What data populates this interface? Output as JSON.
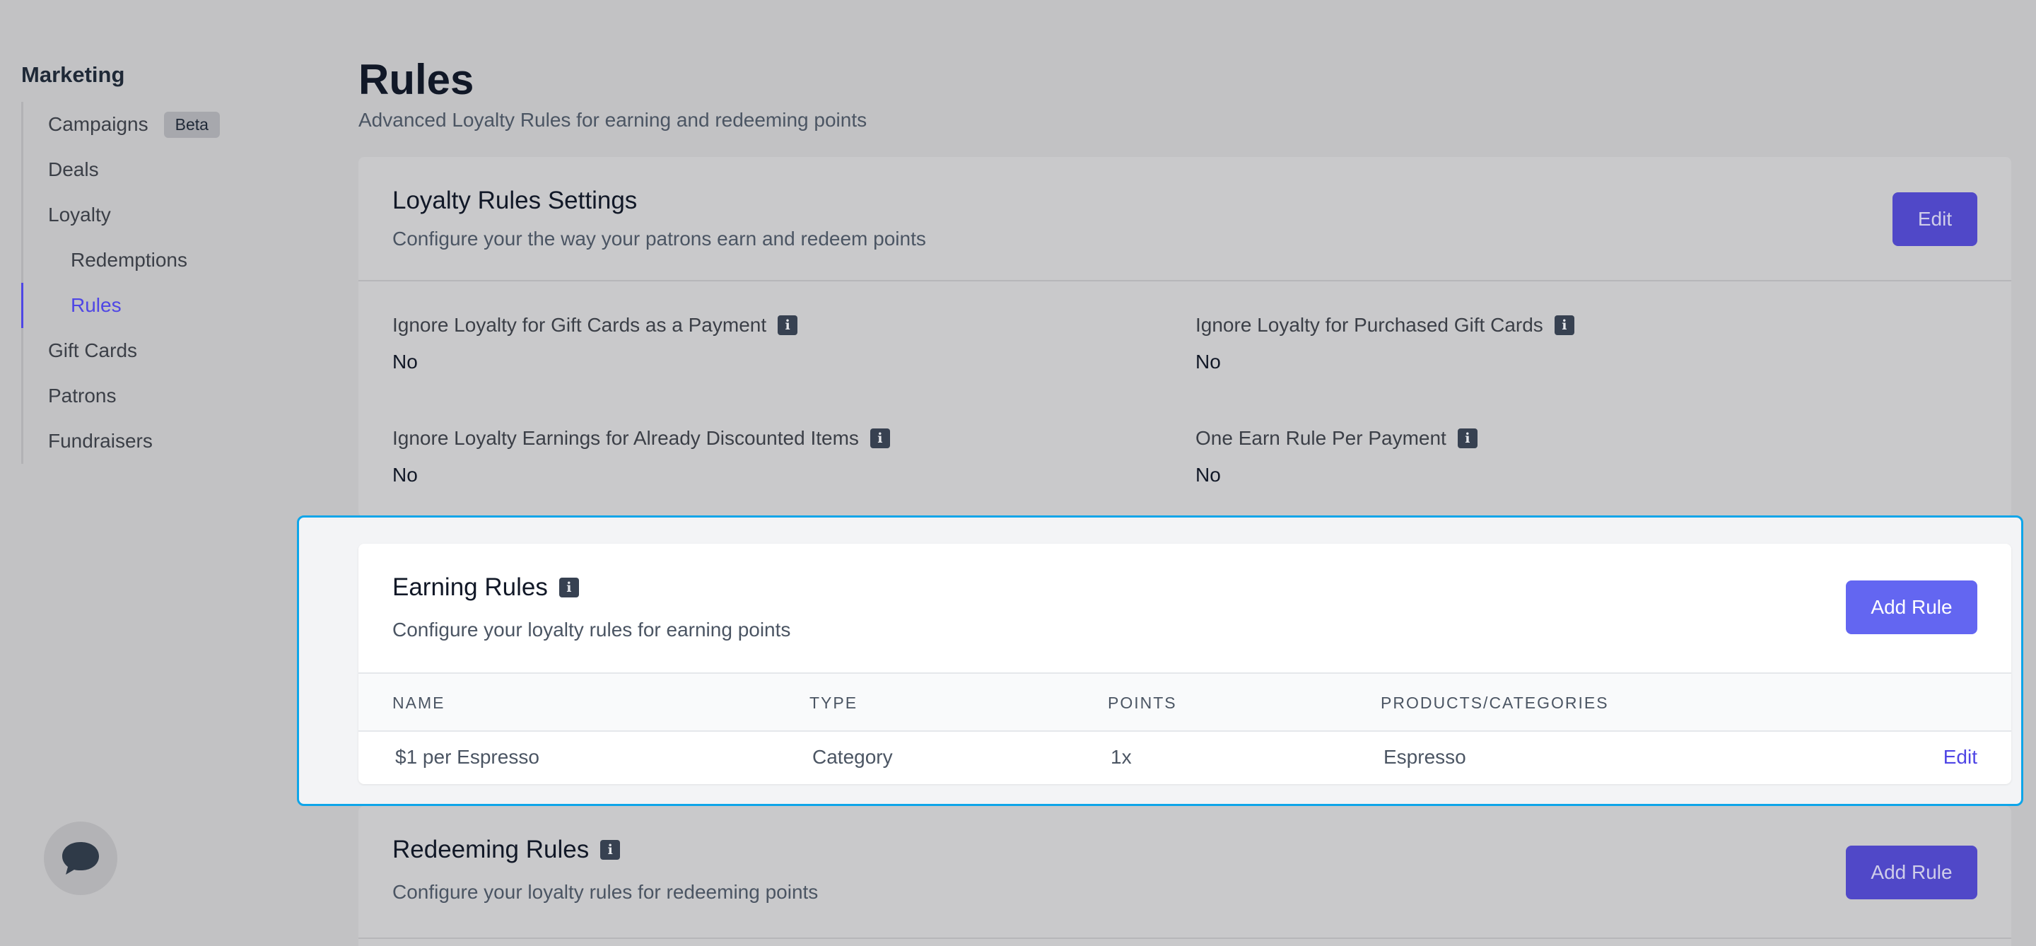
{
  "sidebar": {
    "title": "Marketing",
    "items": [
      {
        "label": "Campaigns",
        "badge": "Beta"
      },
      {
        "label": "Deals"
      },
      {
        "label": "Loyalty"
      },
      {
        "label": "Redemptions"
      },
      {
        "label": "Rules"
      },
      {
        "label": "Gift Cards"
      },
      {
        "label": "Patrons"
      },
      {
        "label": "Fundraisers"
      }
    ],
    "active_item": "Rules"
  },
  "page": {
    "title": "Rules",
    "subtitle": "Advanced Loyalty Rules for earning and redeeming points"
  },
  "settings": {
    "title": "Loyalty Rules Settings",
    "description": "Configure your the way your patrons earn and redeem points",
    "edit_label": "Edit",
    "items": [
      {
        "label": "Ignore Loyalty for Gift Cards as a Payment",
        "value": "No"
      },
      {
        "label": "Ignore Loyalty for Purchased Gift Cards",
        "value": "No"
      },
      {
        "label": "Ignore Loyalty Earnings for Already Discounted Items",
        "value": "No"
      },
      {
        "label": "One Earn Rule Per Payment",
        "value": "No"
      }
    ]
  },
  "earning": {
    "title": "Earning Rules",
    "description": "Configure your loyalty rules for earning points",
    "add_label": "Add Rule",
    "columns": [
      "NAME",
      "TYPE",
      "POINTS",
      "PRODUCTS/CATEGORIES"
    ],
    "rows": [
      {
        "name": "$1 per Espresso",
        "type": "Category",
        "points": "1x",
        "products": "Espresso",
        "action": "Edit"
      }
    ]
  },
  "redeeming": {
    "title": "Redeeming Rules",
    "description": "Configure your loyalty rules for redeeming points",
    "add_label": "Add Rule"
  },
  "icons": {
    "info": "info-icon",
    "chat": "chat-bubble-icon"
  },
  "colors": {
    "accent": "#6366f1",
    "active_nav": "#4f46e5",
    "highlight_border": "#0ea5e9"
  }
}
